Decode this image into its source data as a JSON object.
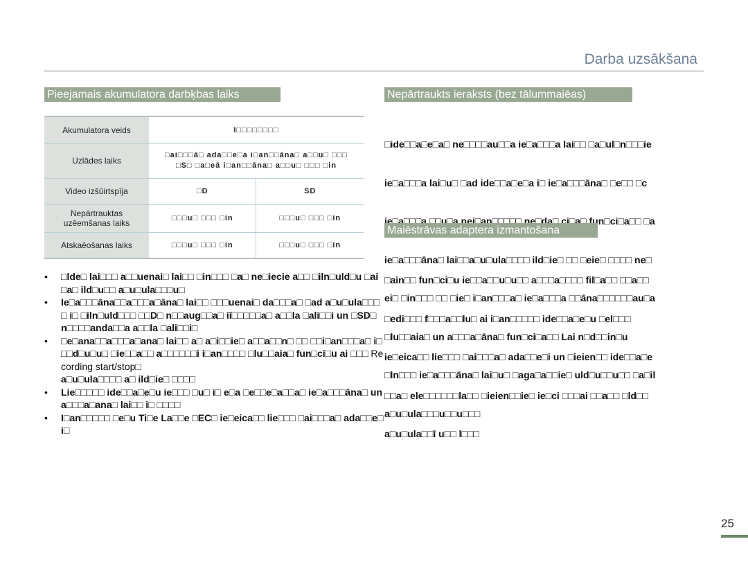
{
  "header": {
    "chapter_title": "Darba uzsākšana"
  },
  "sections": {
    "battery": {
      "title": "Pieejamais akumulatora darbķbas laiks",
      "table": {
        "rows": [
          {
            "label": "Akumulatora veids",
            "values": [
              "I□□□□□□□□"
            ]
          },
          {
            "label": "Uzlādes laiks",
            "values": [
              "□ai□□□ā□ ada□□e□a i□an□□āna□ a□□u□ □□□\n□S□ □a□eā i□an□□āna□ a□□u□ □□□ □in"
            ]
          },
          {
            "label": "Video izšūirtspīja",
            "values": [
              "□D",
              "SD"
            ]
          },
          {
            "label": "Nepārtrauktas uzēemšanas laiks",
            "values": [
              "□□□u□ □□□ □in",
              "□□□u□ □□□ □in"
            ]
          },
          {
            "label": "Atskaēošanas laiks",
            "values": [
              "□□□u□ □□□ □in",
              "□□□u□ □□□ □in"
            ]
          }
        ]
      },
      "notes": [
        "□lde□ lai□□□ a□□uenai□ lai□□ □in□□□ □a□ ne□iecie a□□ □iln□uld□u □ai□a□ ild□u□□ a□u□ula□□□u□",
        "Ie□a□□□āna□□a□□□a□āna□ lai□□ □□□uenai□ da□□□a□ □ad a□u□ula□□□□ i□ □iln□uld□□□ □□D□ n□□aug□□a□ iī□□□□□a□ a□□la □ali□□i un □SD□ n□□□□anda□□a a□□la □ali□□i□",
        "□e□ana□□a□□□a□ana□ lai□□ a□ a□i□□ie□ a□□a□□n□ □□ □□i□an□□□a□ i□□□d□u□u□ □ie□□a□□ a□□□□□□i i□an□□□□ □lu□□aia□ fun□ci□u ai □□□",
        "Lie□□□□□ ide□□a□e□u ie□□□ □u□ i□ e□a □e□□e□a□□a□ ie□a□□□āna□ un a□□□a□ana□ lai□□ i□ □□□□",
        "I□an□□□□□ □e□u Ti□e La□□e □EC□ ie□eica□□ lie□□□ □ai□□□a□ ada□□e□i□"
      ],
      "note3_suffix": "Recording start/stop□",
      "note3_tail": "a□u□ula□□□□ a□ ild□ie□ □□□□"
    },
    "continuous": {
      "title": "Nepārtraukts ieraksts (bez tālummaiēas)",
      "lines": [
        "□ide□□a□e□a□ ne□□□□au□□a ie□a□□□a lai□□ □a□ul□n□□□ie",
        "ie□a□□□a lai□u□ □ad ide□□a□e□a i□ ie□a□□□āna□ □e□□ □c",
        "ie□a□□□a □□u□a nei□an□□□□□ ne□da□ ci□a□ fun□ci□a□□ □a",
        "ie□a□□□āna□ lai□□a□u□ula□□□□ ild□ie□ □□ □eie□ □□□□ ne□",
        "ei□ □in□□□ □□ □ie□ i□an□□□a□ ie□a□□□a □□āna□□□□□□au□a",
        "□lu□□aia□ un a□□□a□āna□ fun□ci□a□□ Lai n□d□□in□u",
        "□ln□□□ ie□a□□□āna□ lai□u□ □aga□a□□ie□ uld□u□□u□□ □a□il",
        "a□u□ula□□□u□□u□□□"
      ]
    },
    "adapter": {
      "title": "Maiēstrāvas adaptera izmantošana",
      "lines": [
        "□ain□□ fun□ci□u ie□□a□□u□u□□ a□□□a□□□□ fil□a□□ □□a□□",
        "□edi□□□ f□□□a□□lu□ ai i□an□□□□□ ide□□a□e□u □el□□□",
        "ie□eica□□ lie□□□ □ai□□□a□ ada□□e□i un □ieien□□ ide□□a□e",
        "□□a□ ele□□□□□□la□□ □ieien□□ie□ ie□ci □□□ai □□a□□ □ld□□",
        "a□u□ula□□ī u□□ l□□□"
      ]
    }
  },
  "footer": {
    "page_number": "25"
  }
}
